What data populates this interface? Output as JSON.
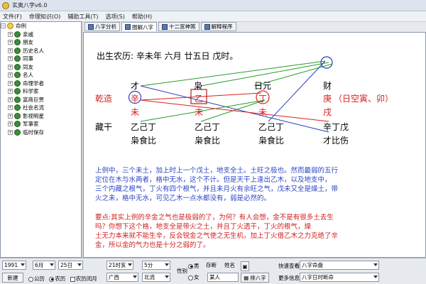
{
  "window": {
    "title": "玄奥八字v6.0"
  },
  "menu": [
    "文件(F)",
    "命理知识(O)",
    "辅助工具(T)",
    "选项(S)",
    "帮助(H)"
  ],
  "sidebar": {
    "root": "命例",
    "items": [
      "亲戚",
      "朋友",
      "历史名人",
      "同事",
      "同友",
      "名人",
      "命理学者",
      "科学家",
      "富商巨贾",
      "社会名流",
      "影视明星",
      "军事家",
      "临时保存"
    ]
  },
  "tabs": [
    "八字分析",
    "图解八字",
    "十二宫神煞",
    "解释程序"
  ],
  "chart": {
    "header": "出生农历:  辛未年  六月  廿五日  戊时。",
    "shishen_top": [
      "才",
      "枭",
      "日元",
      "财"
    ],
    "qianzao": "乾造",
    "stems": [
      "辛",
      "乙",
      "丁",
      "庚"
    ],
    "stem_note": "（日空寅、卯）",
    "branches": [
      "未",
      "未",
      "未",
      "戌"
    ],
    "canggan_label": "藏干",
    "hidden": [
      "乙己丁",
      "乙己丁",
      "乙己丁",
      "辛丁戊"
    ],
    "hidden_shishen": [
      "枭食比",
      "枭食比",
      "枭食比",
      "才比伤"
    ]
  },
  "analysis": {
    "para1": [
      "上例中，三个未土，加上时上一个戊土，地支全土。土旺之极也。然而最弱的五行",
      "定位在木与水两者，格中无水，这个不计。但是天干上逢出乙木，以及地支中，",
      "三个内藏之根气，丁火有四个根气，并且未月火有余旺之气，戊未又全是燥土，带",
      "火之未，格中无水，可见乙木一点水都没有，弱是必然的。"
    ],
    "para2": [
      "要点:其实上例的辛金之气也是极弱的了，为何？有人会想，金不是有很多土去生",
      "吗？你想下这个格，地支全是带火之土，并且丁火透干，丁火的根气，燥",
      "土无力本来就不能生辛，反会锐金之气使之无生机，加上丁火借乙木之力克绝了辛",
      "金，所以金的气力也是十分之弱的了。"
    ]
  },
  "bottom": {
    "year": "1991",
    "month": "6月",
    "day": "25日",
    "hour": "21时亥",
    "minute": "5分",
    "new_btn": "新建",
    "gongli": "公历",
    "nongli": "农历",
    "nongli_run": "农历闰月",
    "province": "广西",
    "city": "北流",
    "sex_label": "性别",
    "male": "男",
    "female": "女",
    "save": "存断",
    "name_label": "姓名",
    "name_value": "某人",
    "paibazi": "排八字",
    "quickview_label": "快速查看",
    "quickview_value": "八字命盘",
    "more_label": "更多信息",
    "more_value": "八字日时断命"
  },
  "colors": {
    "red": "#d82020",
    "blue": "#2040c0",
    "green": "#2a9a2a"
  }
}
